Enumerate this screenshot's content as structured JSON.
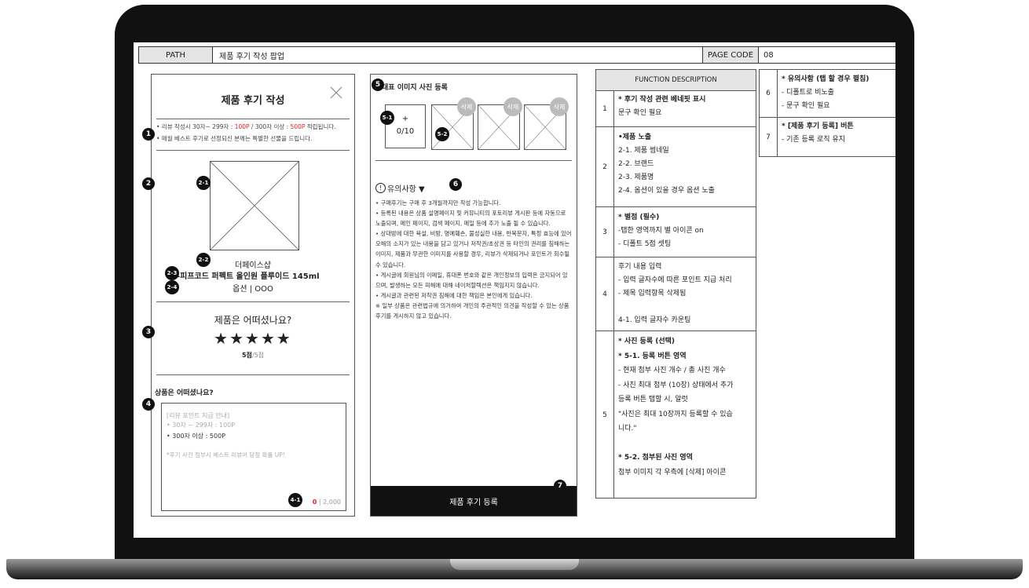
{
  "header": {
    "path_label": "PATH",
    "path_value": "제품 후기 작성 팝업",
    "page_code_label": "PAGE CODE",
    "page_code_value": "08"
  },
  "popup": {
    "title": "제품 후기 작성",
    "benefit_line1_a": "• 리뷰 작성시 30자~ 299자 : ",
    "benefit_line1_b": "100P",
    "benefit_line1_c": " / 300자 이상 : ",
    "benefit_line1_d": "500P",
    "benefit_line1_e": " 적립됩니다.",
    "benefit_line2": "• 매월 베스트 후기로 선정되신 분께는 특별한 선물을 드립니다.",
    "brand": "더페이스샵",
    "product_name": "-피프코드 퍼펙트 올인원 플루이드 145ml",
    "option": "옵션  |  OOO",
    "rating_question": "제품은 어떠셨나요?",
    "stars": "★★★★★",
    "score_bold": "5점",
    "score_total": "/5점",
    "review_question": "상품은 어떠셨나요?",
    "placeholder_1": "[리뷰 포인트 지급 안내]",
    "placeholder_2": "• 30자 ~ 299자 : 100P",
    "placeholder_3": "• 300자 이상 : 500P",
    "placeholder_4": "*후기 사진 첨부시 베스트 리뷰어 당첨 확률 UP!",
    "count_current": "0",
    "count_max": "| 2,000"
  },
  "photo_panel": {
    "title": "대표 이미지 사진 등록",
    "add_plus": "+",
    "add_count": "0/10",
    "delete_label": "삭제",
    "notice_title": "유의사항 ▼",
    "notice_icon": "!",
    "notices": [
      "• 구매후기는 구매 후 3개월까지만 작성 가능합니다.",
      "• 등록된 내용은 상품 설명페이지 및 커뮤니티의 포토리뷰 게시판 등에 자동으로 노출되며, 메인 페이지, 검색 페이지, 메일 등에 추가 노출 될 수 있습니다.",
      "• 상대방에 대한 욕설, 비방, 명예훼손, 불성실한 내용, 반복문자, 특정 효능에 있어 오해의 소지가 있는 내용을 담고 있거나 저작권/초상권 등 타인의 권리를 침해하는 이미지, 제품과 무관한 이미지를 사용할 경우, 리뷰가 삭제되거나 포인트가 회수될 수 있습니다.",
      "• 게시글에 회원님의 이메일, 휴대폰 번호와 같은 개인정보의 입력은 금지되어 있으며, 발생하는 모든 피해에 대해 네이처할렉션은 책임지지 않습니다.",
      "• 게시글과 관련된 저작권 침해에 대한 책임은 본인에게 있습니다.",
      " ※ 일부 상품은 관련법규에 의거하여 개인의 주관적인 의견을 작성할 수 있는 상품 후기를 게시하지 않고 있습니다."
    ],
    "submit_label": "제품 후기 등록"
  },
  "badges": {
    "b1": "1",
    "b2": "2",
    "b21": "2-1",
    "b22": "2-2",
    "b23": "2-3",
    "b24": "2-4",
    "b3": "3",
    "b4": "4",
    "b41": "4-1",
    "b5": "5",
    "b51": "5-1",
    "b52": "5-2",
    "b6": "6",
    "b7": "7"
  },
  "function_table": {
    "header": "FUNCTION DESCRIPTION",
    "rows": [
      {
        "num": "1",
        "lines": [
          "* 후기 작성 관련 베네핏 표시",
          "  문구 확인 필요"
        ]
      },
      {
        "num": "2",
        "lines": [
          "•제품 노출",
          "2-1. 제품 썸네일",
          "2-2. 브랜드",
          "2-3. 제품명",
          "2-4. 옵션이 있을 경우 옵션 노출"
        ]
      },
      {
        "num": "3",
        "lines": [
          "* 별점 (필수)",
          "-탭한 영역까지 별 아이콘 on",
          "- 디폴트 5점 셋팅"
        ]
      },
      {
        "num": "4",
        "lines": [
          "후기 내용 입력",
          "- 입력 글자수에 따른 포인트 지급 처리",
          "- 제목 입력항목 삭제됨",
          "",
          "4-1. 입력 글자수 카운팅"
        ]
      },
      {
        "num": "5",
        "lines": [
          "* 사진 등록 (선택)",
          "* 5-1. 등록 버튼 영역",
          "- 현재 첨부 사진 개수 / 총 사진 개수",
          "- 사진 최대 첨부 (10장) 상태에서 추가",
          "등록 버튼 탭할 시, 알럿",
          " \"사진은 최대 10장까지 등록할 수 있습",
          "니다.\"",
          "",
          "* 5-2. 첨부된 사진 영역",
          "첨부 이미지 각 우측에 [삭제] 아이콘"
        ]
      }
    ]
  },
  "side_table": {
    "rows": [
      {
        "num": "6",
        "lines": [
          "* 유의사항 (탭 할 경우 펼침)",
          "  - 디폴트로 비노출",
          "  - 문구 확인 필요"
        ]
      },
      {
        "num": "7",
        "lines": [
          "* [제품 후기 등록] 버튼",
          "- 기존 등록 로직 유지"
        ]
      }
    ]
  },
  "colors": {
    "accent_red": "#e02020",
    "frame": "#111111",
    "submit_bg": "#111111"
  }
}
